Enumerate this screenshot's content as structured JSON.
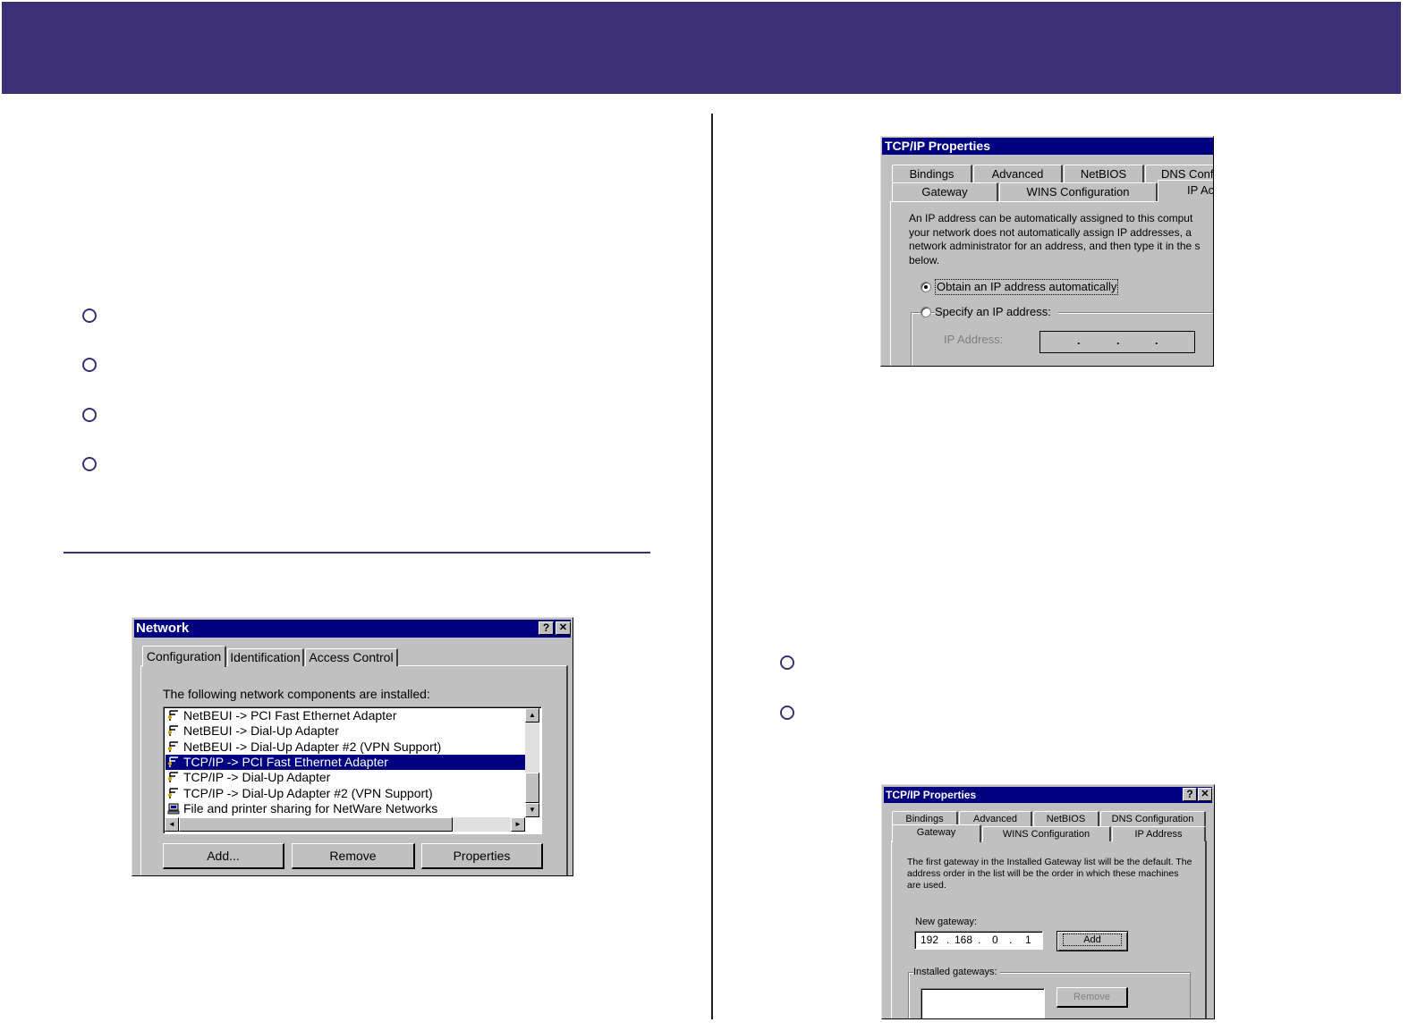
{
  "colors": {
    "accent": "#3c2f78",
    "title_bar": "#000080",
    "dialog_face": "#c0c0c0"
  },
  "network_dialog": {
    "title": "Network",
    "help_glyph": "?",
    "close_glyph": "✕",
    "tabs": [
      "Configuration",
      "Identification",
      "Access Control"
    ],
    "label": "The following network components are installed:",
    "components": [
      {
        "text": "NetBEUI -> PCI Fast Ethernet Adapter",
        "icon": "protocol-icon"
      },
      {
        "text": "NetBEUI -> Dial-Up Adapter",
        "icon": "protocol-icon"
      },
      {
        "text": "NetBEUI -> Dial-Up Adapter #2 (VPN Support)",
        "icon": "protocol-icon"
      },
      {
        "text": "TCP/IP -> PCI Fast Ethernet Adapter",
        "icon": "protocol-icon",
        "selected": true
      },
      {
        "text": "TCP/IP -> Dial-Up Adapter",
        "icon": "protocol-icon"
      },
      {
        "text": "TCP/IP -> Dial-Up Adapter #2 (VPN Support)",
        "icon": "protocol-icon"
      },
      {
        "text": "File and printer sharing for NetWare Networks",
        "icon": "file-sharing-icon"
      }
    ],
    "buttons": {
      "add": "Add...",
      "remove": "Remove",
      "properties": "Properties"
    }
  },
  "tcpip_ip_dialog": {
    "title": "TCP/IP Properties",
    "tabs_row1": [
      "Bindings",
      "Advanced",
      "NetBIOS",
      "DNS Conf"
    ],
    "tabs_row2": [
      "Gateway",
      "WINS Configuration",
      "IP Ac"
    ],
    "description": [
      "An IP address can be automatically assigned to this comput",
      "your network does not automatically assign IP addresses, a",
      "network administrator for an address, and then type it in the s",
      "below."
    ],
    "option_auto": "Obtain an IP address automatically",
    "option_specify": "Specify an IP address:",
    "ip_label": "IP Address:",
    "ip_dots": [
      "."
    ]
  },
  "tcpip_gateway_dialog": {
    "title": "TCP/IP Properties",
    "help_glyph": "?",
    "close_glyph": "✕",
    "tabs_row1": [
      "Bindings",
      "Advanced",
      "NetBIOS",
      "DNS Configuration"
    ],
    "tabs_row2": [
      "Gateway",
      "WINS Configuration",
      "IP Address"
    ],
    "description": [
      "The first gateway in the Installed Gateway list will be the default. The",
      "address order in the list will be the order in which these machines",
      "are used."
    ],
    "new_gateway_label": "New gateway:",
    "gateway_octets": [
      "192",
      "168",
      "0",
      "1"
    ],
    "add_button": "Add",
    "installed_label": "Installed gateways:",
    "remove_button": "Remove"
  }
}
